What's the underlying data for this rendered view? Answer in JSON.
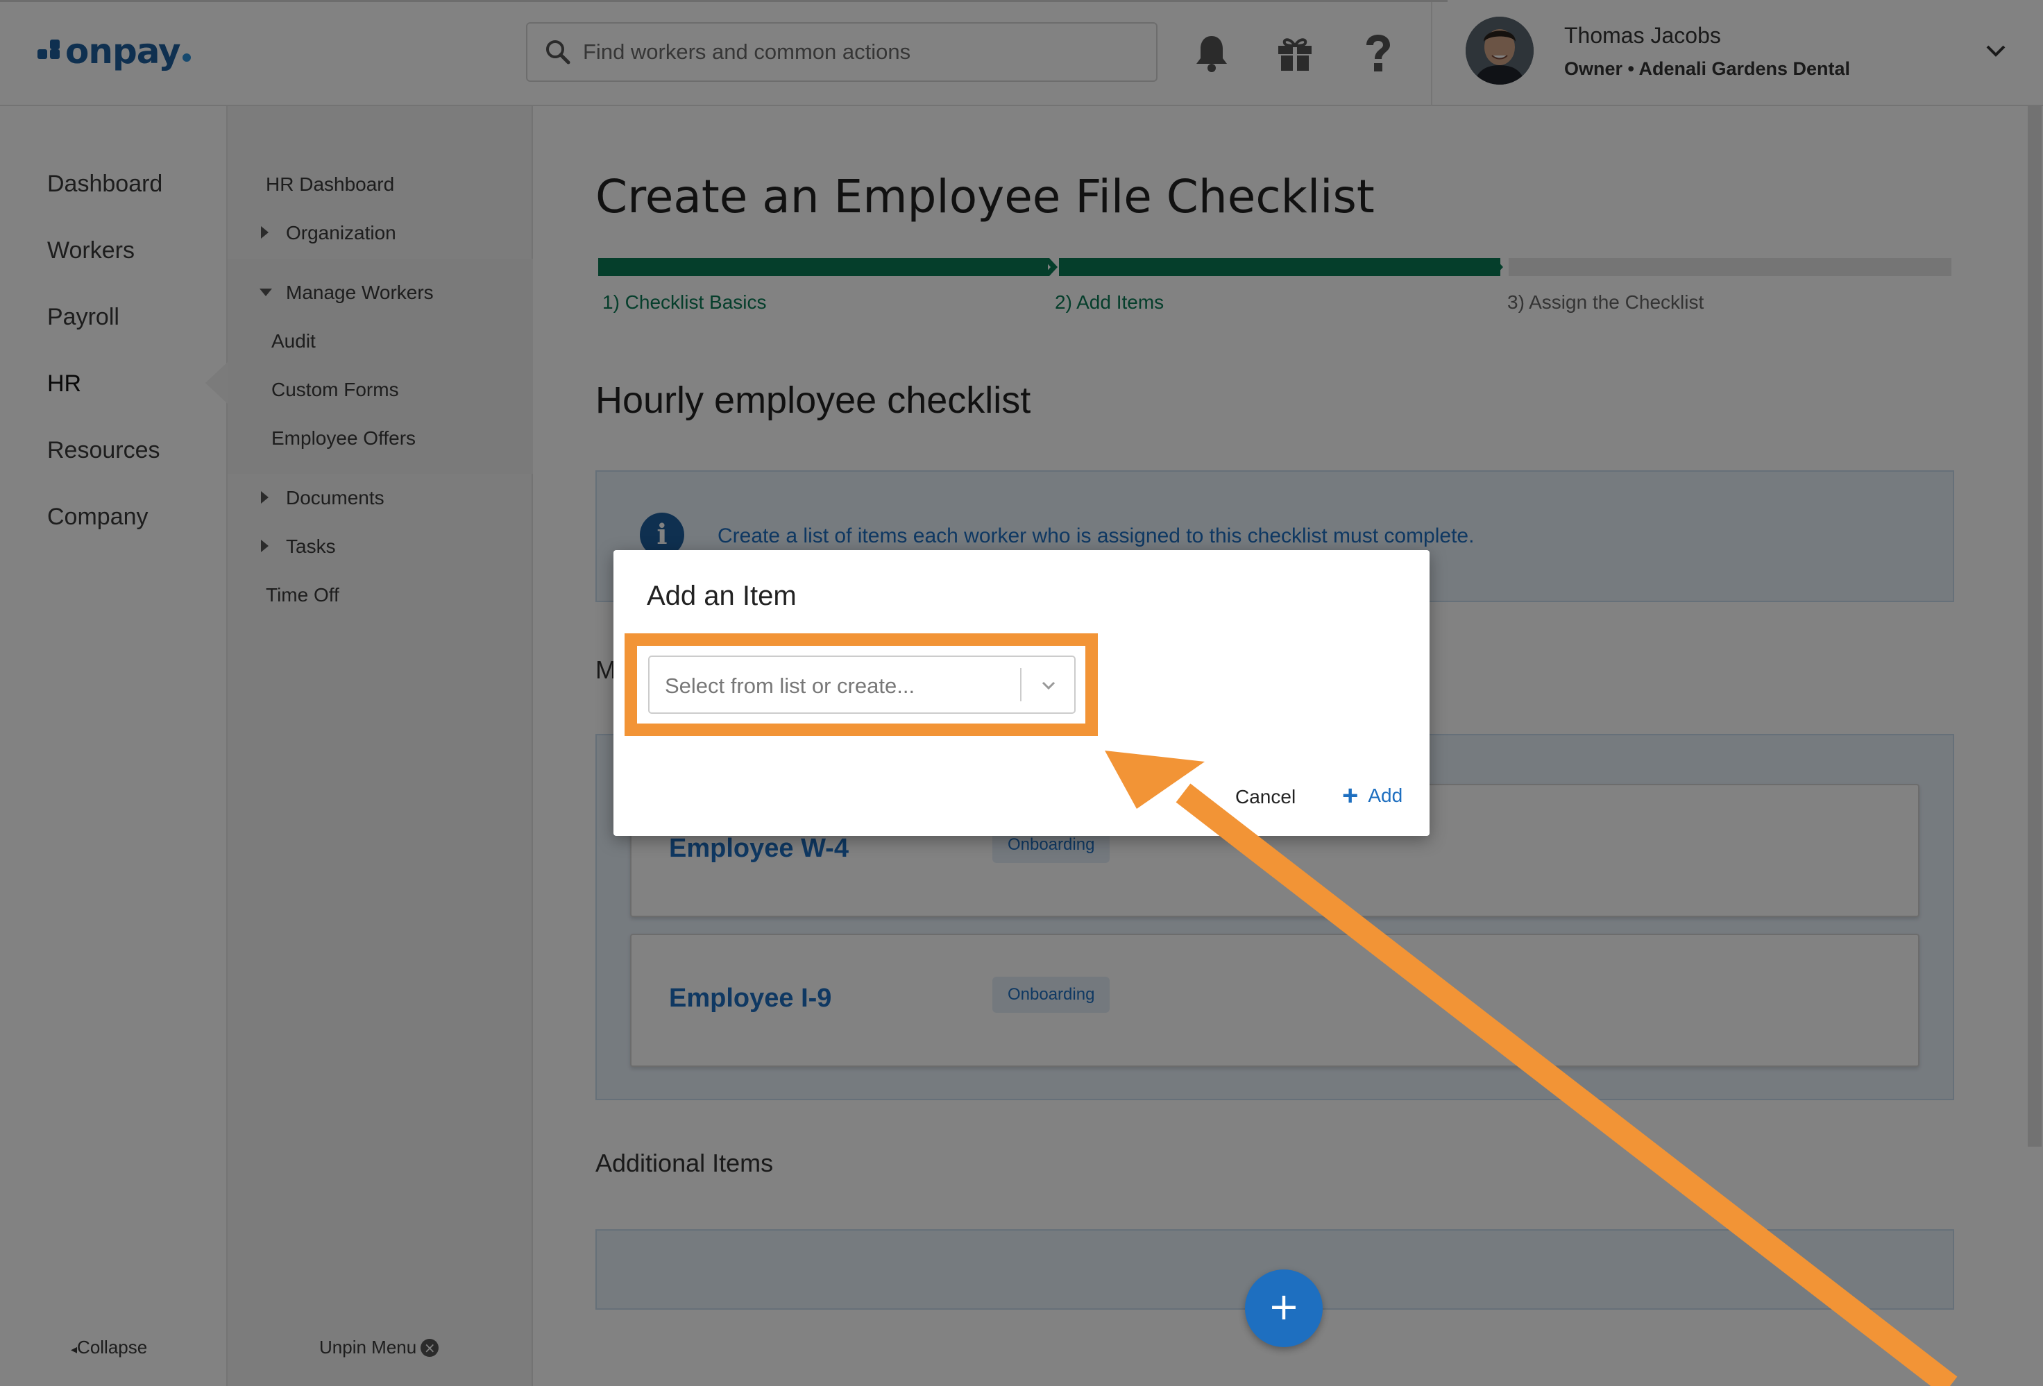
{
  "brand": {
    "logo_text": "onpay"
  },
  "header": {
    "search_placeholder": "Find workers and common actions",
    "icons": [
      "bell-icon",
      "gift-icon",
      "help-icon"
    ],
    "user": {
      "name": "Thomas Jacobs",
      "role": "Owner • Adenali Gardens Dental"
    }
  },
  "primary_nav": {
    "items": [
      {
        "label": "Dashboard"
      },
      {
        "label": "Workers"
      },
      {
        "label": "Payroll"
      },
      {
        "label": "HR",
        "active": true
      },
      {
        "label": "Resources"
      },
      {
        "label": "Company"
      }
    ],
    "collapse_label": "Collapse"
  },
  "secondary_nav": {
    "hr_dashboard": "HR Dashboard",
    "organization": "Organization",
    "manage_workers": "Manage Workers",
    "audit": "Audit",
    "custom_forms": "Custom Forms",
    "employee_offers": "Employee Offers",
    "documents": "Documents",
    "tasks": "Tasks",
    "time_off": "Time Off",
    "unpin_label": "Unpin Menu"
  },
  "page": {
    "title": "Create an Employee File Checklist",
    "steps": [
      {
        "label": "1) Checklist Basics",
        "state": "complete"
      },
      {
        "label": "2) Add Items",
        "state": "current"
      },
      {
        "label": "3) Assign the Checklist",
        "state": "pending"
      }
    ],
    "checklist_name": "Hourly employee checklist",
    "info_text": "Create a list of items each worker who is assigned to this checklist must complete.",
    "mandatory_heading_partial": "M",
    "items": [
      {
        "name": "Employee W-4",
        "badge": "Onboarding"
      },
      {
        "name": "Employee I-9",
        "badge": "Onboarding"
      }
    ],
    "additional_heading": "Additional Items",
    "fab_label": "+"
  },
  "modal": {
    "title": "Add an Item",
    "select_placeholder": "Select from list or create...",
    "cancel_label": "Cancel",
    "add_label": "Add"
  },
  "colors": {
    "brand_blue": "#1e5f9e",
    "link_blue": "#1e6fc0",
    "progress_green": "#0b7a55",
    "highlight_orange": "#f29436"
  }
}
